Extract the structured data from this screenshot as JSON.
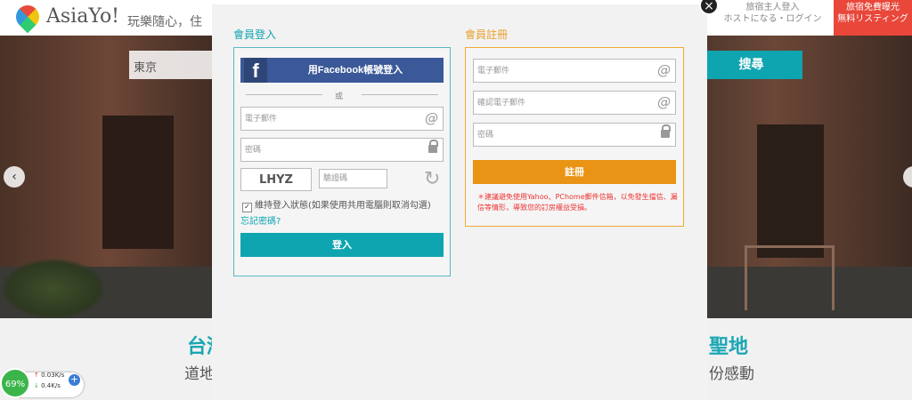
{
  "site": {
    "logo_text": "AsiaYo!",
    "slogan": "玩樂隨心，住",
    "host_login_line1": "旅宿主人登入",
    "host_login_line2": "ホストになる・ログイン",
    "host_free_line1": "旅宿免費曝光",
    "host_free_line2": "無料リスティング"
  },
  "search": {
    "value": "東京",
    "button_label": "搜尋"
  },
  "hero": {
    "prev_arrow": "‹",
    "next_arrow": "›"
  },
  "lower": {
    "left_title": "台灣",
    "left_sub": "道地",
    "right_title": "聖地",
    "right_sub": "份感動"
  },
  "modal": {
    "close_symbol": "×",
    "login": {
      "title": "會員登入",
      "facebook_label": "用Facebook帳號登入",
      "facebook_glyph": "f",
      "or_text": "或",
      "email_placeholder": "電子郵件",
      "password_placeholder": "密碼",
      "captcha_text": "LHYZ",
      "captcha_placeholder": "驗證碼",
      "remember_label": "維持登入狀態(如果使用共用電腦則取消勾選)",
      "remember_checked": true,
      "forgot_label": "忘記密碼?",
      "submit_label": "登入"
    },
    "register": {
      "title": "會員註冊",
      "email_placeholder": "電子郵件",
      "confirm_email_placeholder": "確認電子郵件",
      "password_placeholder": "密碼",
      "submit_label": "註冊",
      "notice": "＊建議避免使用Yahoo、PChome郵件信箱，以免發生擋信、漏信等情形，導致您的訂房權益受損。"
    }
  },
  "network_widget": {
    "percent": "69%",
    "upload": "0.03K/s",
    "download": "0.4K/s",
    "plus_symbol": "+"
  },
  "colors": {
    "accent": "#0fa5b0",
    "register_accent": "#e99414",
    "facebook": "#3b5998",
    "notice_red": "#e33333"
  }
}
